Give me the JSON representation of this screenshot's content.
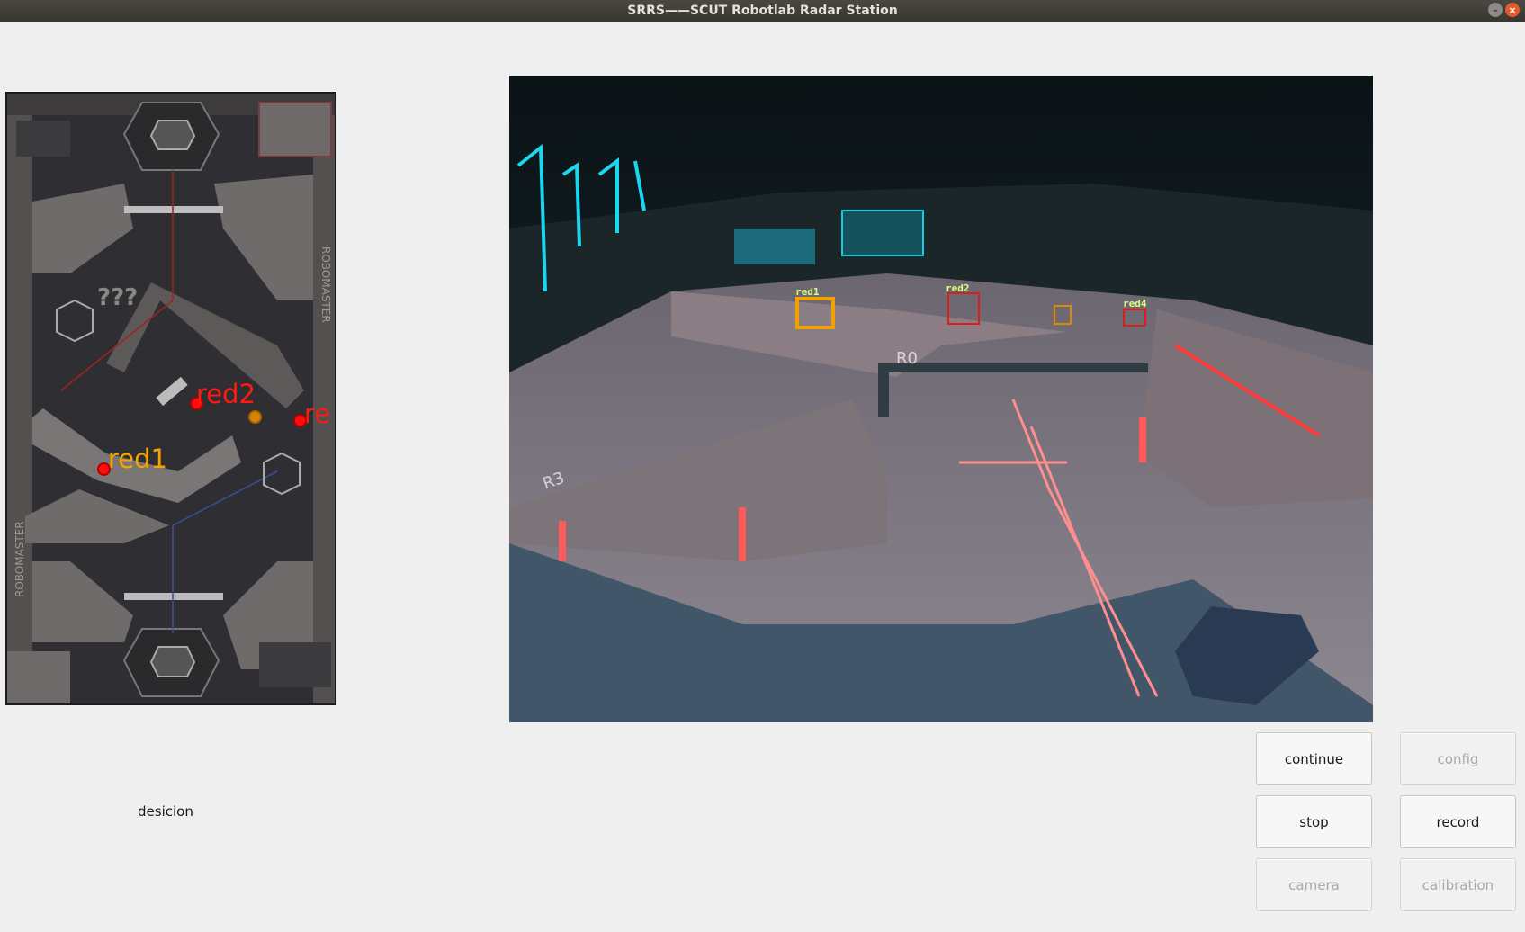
{
  "window": {
    "title": "SRRS——SCUT Robotlab Radar Station"
  },
  "minimap": {
    "markers": [
      {
        "label": "red2",
        "color": "#ff1a10"
      },
      {
        "label": "red1",
        "color": "#f5a300"
      },
      {
        "label": "re",
        "color": "#ff1a10"
      }
    ],
    "engraved_text": [
      "ROBOMASTER",
      "ROBOMASTER",
      "???"
    ]
  },
  "decision_label": "desicion",
  "camera": {
    "detections": [
      {
        "label": "red1",
        "box_color": "#f2a100"
      },
      {
        "label": "red2",
        "box_color": "#e11a1a"
      },
      {
        "label": "",
        "box_color": "#e08a00"
      },
      {
        "label": "red4",
        "box_color": "#e11a1a"
      }
    ],
    "field_marks": [
      "R0",
      "R3"
    ]
  },
  "buttons": {
    "continue": {
      "label": "continue",
      "enabled": true
    },
    "config": {
      "label": "config",
      "enabled": false
    },
    "stop": {
      "label": "stop",
      "enabled": true
    },
    "record": {
      "label": "record",
      "enabled": true
    },
    "camera": {
      "label": "camera",
      "enabled": false
    },
    "calibration": {
      "label": "calibration",
      "enabled": false
    }
  }
}
